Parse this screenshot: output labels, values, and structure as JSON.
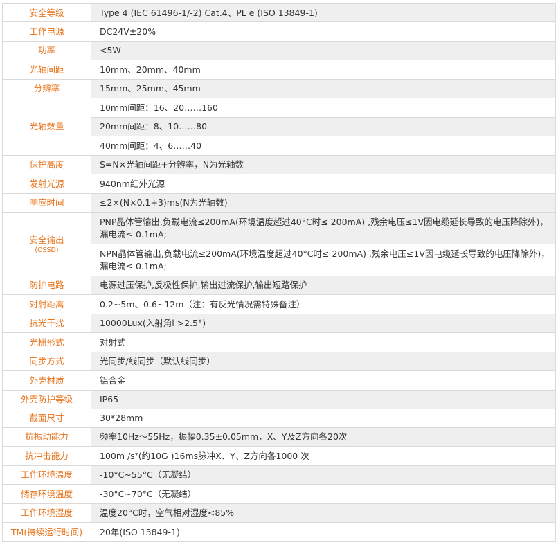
{
  "rows": [
    {
      "label": "安全等级",
      "value": "Type 4 (IEC 61496-1/-2) Cat.4、PL e (ISO 13849-1)"
    },
    {
      "label": "工作电源",
      "value": "DC24V±20%"
    },
    {
      "label": "功率",
      "value": "<5W"
    },
    {
      "label": "光轴间距",
      "value": "10mm、20mm、40mm"
    },
    {
      "label": "分辨率",
      "value": "15mm、25mm、45mm"
    },
    {
      "label": "光轴数量",
      "values": [
        "10mm间距：16、20……160",
        "20mm间距：8、10……80",
        "40mm间距：4、6……40"
      ]
    },
    {
      "label": "保护高度",
      "value": "S=N×光轴间距+分辨率，N为光轴数"
    },
    {
      "label": "发射光源",
      "value": "940nm红外光源"
    },
    {
      "label": "响应时间",
      "value": "≤2×(N×0.1+3)ms(N为光轴数)"
    },
    {
      "label": "安全输出",
      "sublabel": "(OSSD)",
      "values": [
        "PNP晶体管输出,负载电流≤200mA(环境温度超过40°C时≤ 200mA) ,残余电压≤1V因电缆延长导致的电压降除外)，漏电流≤ 0.1mA;",
        "NPN晶体管输出,负载电流≤200mA(环境温度超过40°C时≤ 200mA) ,残余电压≤1V因电缆延长导致的电压降除外)，漏电流≤ 0.1mA;"
      ]
    },
    {
      "label": "防护电路",
      "value": "电源过压保护,反极性保护,输出过流保护,输出短路保护"
    },
    {
      "label": "对射距离",
      "value": "0.2~5m、0.6~12m（注：有反光情况需特殊备注）"
    },
    {
      "label": "抗光干扰",
      "value": "10000Lux(入射角l >2.5°)"
    },
    {
      "label": "光栅形式",
      "value": "对射式"
    },
    {
      "label": "同步方式",
      "value": "光同步/线同步（默认线同步）"
    },
    {
      "label": "外壳材质",
      "value": "铝合金"
    },
    {
      "label": "外壳防护等级",
      "value": "IP65"
    },
    {
      "label": "截面尺寸",
      "value": "30*28mm"
    },
    {
      "label": "抗振动能力",
      "value": "频率10Hz～55Hz，振幅0.35±0.05mm，X、Y及Z方向各20次"
    },
    {
      "label": "抗冲击能力",
      "value": "100m /s²(约10G )16ms脉冲X、Y、Z方向各1000 次"
    },
    {
      "label": "工作环境温度",
      "value": "-10°C~55°C（无凝结）"
    },
    {
      "label": "储存环境温度",
      "value": "-30°C~70°C（无凝结）"
    },
    {
      "label": "工作环境湿度",
      "value": "温度20°C时，空气相对湿度<85%"
    },
    {
      "label": "TM(持续运行时间)",
      "value": "20年(ISO 13849-1)"
    }
  ]
}
